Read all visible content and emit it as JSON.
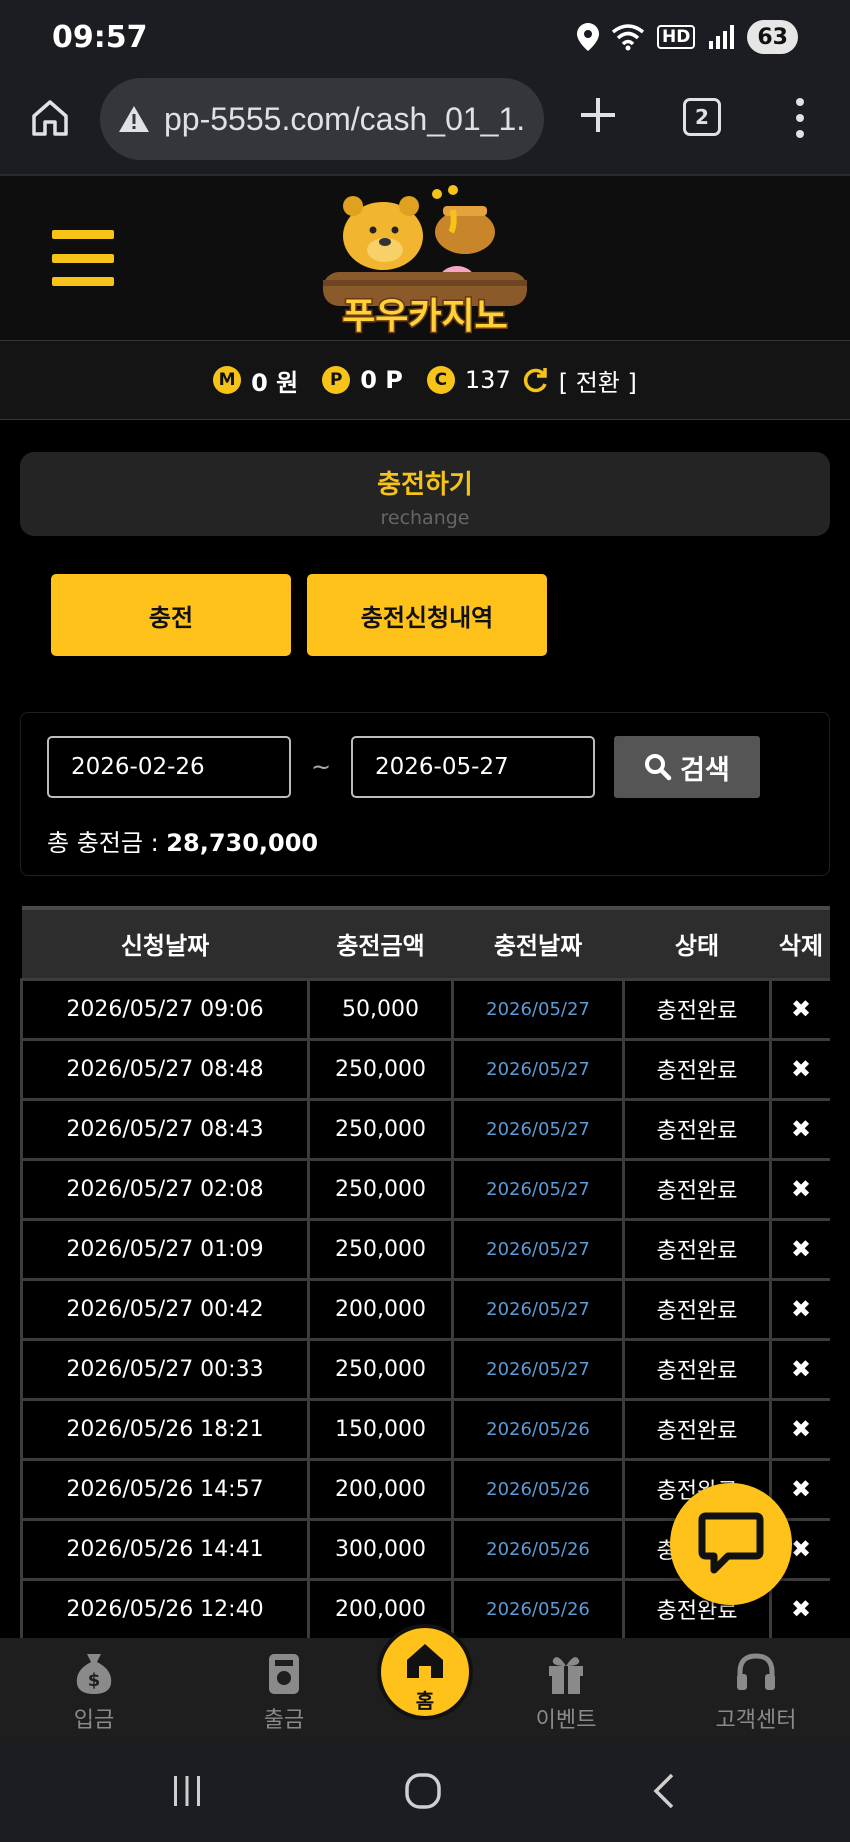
{
  "status_bar": {
    "time": "09:57",
    "hd_label": "HD",
    "battery": "63",
    "icons": [
      "location-icon",
      "wifi-icon",
      "signal-icon",
      "battery-icon"
    ]
  },
  "browser": {
    "url": "pp-5555.com/cash_01_1.",
    "tab_count": "2",
    "icons": [
      "home-icon",
      "warning-icon",
      "plus-icon",
      "tabs-icon",
      "more-vert-icon"
    ]
  },
  "header": {
    "logo_text": "푸우카지노"
  },
  "balance": {
    "money_icon": "M",
    "money": "0 원",
    "point_icon": "P",
    "point": "0 P",
    "comp_icon": "C",
    "comp": "137",
    "convert_label": "[ 전환 ]"
  },
  "page_title": {
    "main": "충전하기",
    "sub": "rechange"
  },
  "tabs": {
    "charge": "충전",
    "history": "충전신청내역"
  },
  "search": {
    "start_date": "2026-02-26",
    "end_date": "2026-05-27",
    "tilde": "~",
    "button_label": "검색",
    "total_label": "총 충전금 : ",
    "total_value": "28,730,000"
  },
  "table": {
    "headers": [
      "신청날짜",
      "충전금액",
      "충전날짜",
      "상태",
      "삭제"
    ],
    "rows": [
      {
        "request_date": "2026/05/27 09:06",
        "amount": "50,000",
        "charge_date": "2026/05/27",
        "status": "충전완료",
        "delete": "✖"
      },
      {
        "request_date": "2026/05/27 08:48",
        "amount": "250,000",
        "charge_date": "2026/05/27",
        "status": "충전완료",
        "delete": "✖"
      },
      {
        "request_date": "2026/05/27 08:43",
        "amount": "250,000",
        "charge_date": "2026/05/27",
        "status": "충전완료",
        "delete": "✖"
      },
      {
        "request_date": "2026/05/27 02:08",
        "amount": "250,000",
        "charge_date": "2026/05/27",
        "status": "충전완료",
        "delete": "✖"
      },
      {
        "request_date": "2026/05/27 01:09",
        "amount": "250,000",
        "charge_date": "2026/05/27",
        "status": "충전완료",
        "delete": "✖"
      },
      {
        "request_date": "2026/05/27 00:42",
        "amount": "200,000",
        "charge_date": "2026/05/27",
        "status": "충전완료",
        "delete": "✖"
      },
      {
        "request_date": "2026/05/27 00:33",
        "amount": "250,000",
        "charge_date": "2026/05/27",
        "status": "충전완료",
        "delete": "✖"
      },
      {
        "request_date": "2026/05/26 18:21",
        "amount": "150,000",
        "charge_date": "2026/05/26",
        "status": "충전완료",
        "delete": "✖"
      },
      {
        "request_date": "2026/05/26 14:57",
        "amount": "200,000",
        "charge_date": "2026/05/26",
        "status": "충전완료",
        "delete": "✖"
      },
      {
        "request_date": "2026/05/26 14:41",
        "amount": "300,000",
        "charge_date": "2026/05/26",
        "status": "충전완료",
        "delete": "✖"
      },
      {
        "request_date": "2026/05/26 12:40",
        "amount": "200,000",
        "charge_date": "2026/05/26",
        "status": "충전완료",
        "delete": "✖"
      }
    ]
  },
  "bottom_nav": {
    "deposit": "입금",
    "withdraw": "출금",
    "home": "홈",
    "event": "이벤트",
    "support": "고객센터"
  },
  "colors": {
    "accent": "#ffc21a",
    "date_link": "#5c9bd6",
    "background": "#000000"
  }
}
